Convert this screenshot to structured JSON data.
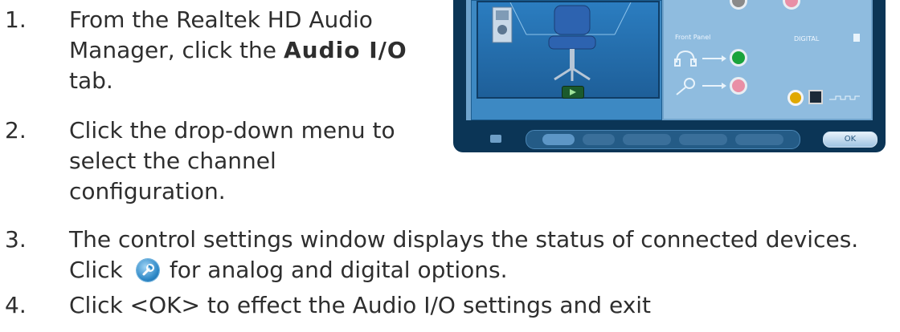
{
  "steps": [
    {
      "number": "1.",
      "lines": [
        "From the Realtek HD Audio",
        "Manager, click the ",
        "Audio I/O",
        "tab."
      ]
    },
    {
      "number": "2.",
      "lines": [
        "Click the drop-down menu to",
        "select the channel",
        "configuration."
      ]
    },
    {
      "number": "3.",
      "lines": [
        "The control settings window displays the status of connected devices.",
        "Click ",
        " for analog and digital options."
      ]
    },
    {
      "number": "4.",
      "lines": [
        "Click <OK> to effect the Audio I/O settings and exit"
      ]
    }
  ],
  "screenshot": {
    "front_panel_label": "Front Panel",
    "digital_label": "DIGITAL",
    "ok_label": "OK"
  },
  "colors": {
    "text": "#2e2e2e",
    "panel_bg": "#0b3556",
    "jack_green": "#1aa33b",
    "jack_pink": "#e98fa6"
  },
  "icons": {
    "options_icon": "wrench-icon"
  }
}
